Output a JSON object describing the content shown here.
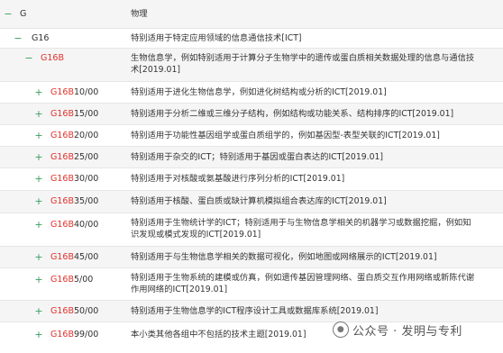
{
  "toggles": {
    "collapse": "−",
    "expand": "+"
  },
  "header": {
    "code": "G",
    "desc": "物理"
  },
  "rows": [
    {
      "prefix": "G16",
      "suffix": "",
      "desc": "特别适用于特定应用领域的信息通信技术[ICT]"
    },
    {
      "prefix": "G16B",
      "suffix": "",
      "desc": "生物信息学，例如特别适用于计算分子生物学中的遗传或蛋白质相关数据处理的信息与通信技术[2019.01]"
    },
    {
      "prefix": "G16B",
      "suffix": "10/00",
      "desc": "特别适用于进化生物信息学，例如进化树结构或分析的ICT[2019.01]"
    },
    {
      "prefix": "G16B",
      "suffix": "15/00",
      "desc": "特别适用于分析二维或三维分子结构，例如结构或功能关系、结构排序的ICT[2019.01]"
    },
    {
      "prefix": "G16B",
      "suffix": "20/00",
      "desc": "特别适用于功能性基因组学或蛋白质组学的，例如基因型-表型关联的ICT[2019.01]"
    },
    {
      "prefix": "G16B",
      "suffix": "25/00",
      "desc": "特别适用于杂交的ICT；特别适用于基因或蛋白表达的ICT[2019.01]"
    },
    {
      "prefix": "G16B",
      "suffix": "30/00",
      "desc": "特别适用于对核酸或氨基酸进行序列分析的ICT[2019.01]"
    },
    {
      "prefix": "G16B",
      "suffix": "35/00",
      "desc": "特别适用于核酸、蛋白质或缺计算机模拟组合表达库的ICT[2019.01]"
    },
    {
      "prefix": "G16B",
      "suffix": "40/00",
      "desc": "特别适用于生物统计学的ICT；特别适用于与生物信息学相关的机器学习或数据挖掘，例如知识发现或模式发现的ICT[2019.01]"
    },
    {
      "prefix": "G16B",
      "suffix": "45/00",
      "desc": "特别适用于与生物信息学相关的数据可视化，例如地图或网络展示的ICT[2019.01]"
    },
    {
      "prefix": "G16B",
      "suffix": "5/00",
      "desc": "特别适用于生物系统的建模或仿真，例如遗传基因管理网络、蛋白质交互作用网络或新陈代谢作用网络的ICT[2019.01]"
    },
    {
      "prefix": "G16B",
      "suffix": "50/00",
      "desc": "特别适用于生物信息学的ICT程序设计工具或数据库系统[2019.01]"
    },
    {
      "prefix": "G16B",
      "suffix": "99/00",
      "desc": "本小类其他各组中不包括的技术主题[2019.01]"
    }
  ],
  "watermark": {
    "text": "公众号 · 发明与专利"
  },
  "colors": {
    "accent_green": "#3a9f5e",
    "code_red": "#e0322c"
  }
}
